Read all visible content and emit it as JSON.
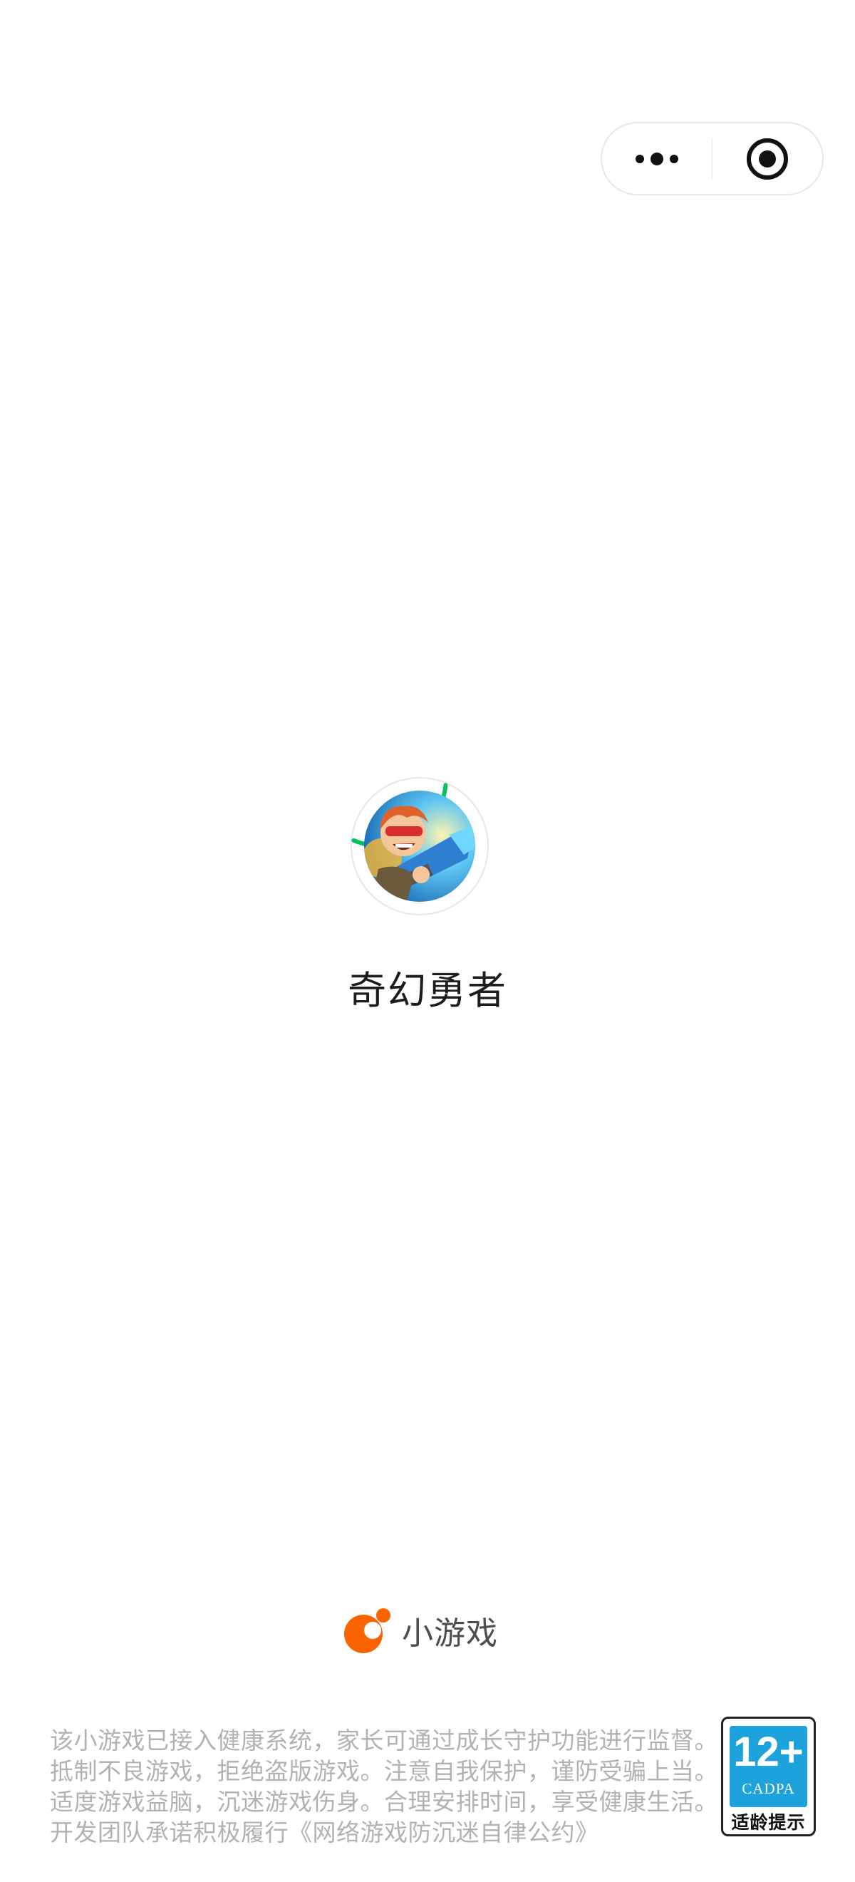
{
  "capsule": {
    "more_icon": "more-dots-icon",
    "close_icon": "target-close-icon"
  },
  "game": {
    "title": "奇幻勇者",
    "icon": "game-hero-icon",
    "loading_progress": 0.3
  },
  "brand": {
    "label": "小游戏",
    "logo_color": "#fa6400"
  },
  "notice": {
    "lines": [
      "该小游戏已接入健康系统，家长可通过成长守护功能进行监督。",
      "抵制不良游戏，拒绝盗版游戏。注意自我保护，谨防受骗上当。",
      "适度游戏益脑，沉迷游戏伤身。合理安排时间，享受健康生活。",
      "开发团队承诺积极履行《网络游戏防沉迷自律公约》"
    ]
  },
  "age_rating": {
    "age": "12+",
    "org": "CADPA",
    "label": "适龄提示",
    "color": "#1ea2dc"
  },
  "colors": {
    "progress": "#07c160",
    "title": "#1c1c1c",
    "notice": "#b2b2b2"
  }
}
